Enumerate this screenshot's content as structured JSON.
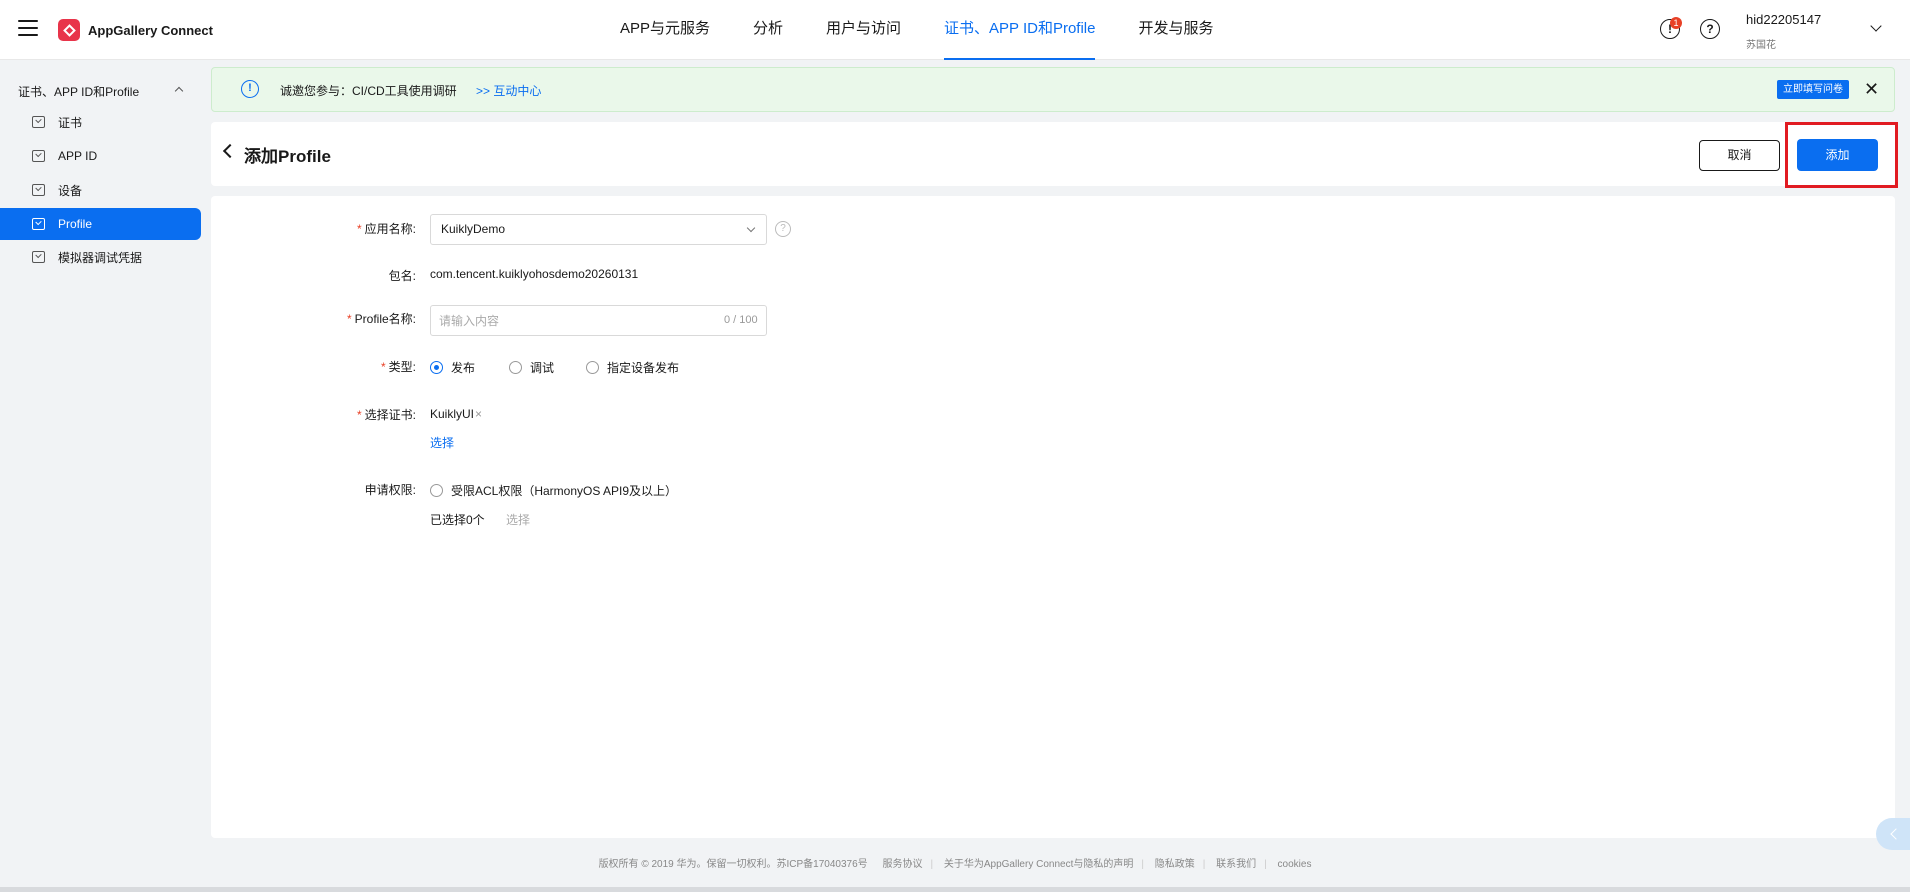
{
  "app": {
    "logo_text": "AppGallery Connect"
  },
  "topnav": {
    "items": [
      "APP与元服务",
      "分析",
      "用户与访问",
      "证书、APP ID和Profile",
      "开发与服务"
    ],
    "active_index": 3
  },
  "header_icons": {
    "notification_badge": "1"
  },
  "user": {
    "id": "hid22205147",
    "name": "苏国花"
  },
  "sidebar": {
    "section_title": "证书、APP ID和Profile",
    "items": [
      "证书",
      "APP ID",
      "设备",
      "Profile",
      "模拟器调试凭据"
    ],
    "active_index": 3
  },
  "notice": {
    "text": "诚邀您参与：CI/CD工具使用调研",
    "link": ">> 互动中心",
    "survey_button": "立即填写问卷"
  },
  "page": {
    "title": "添加Profile",
    "cancel_label": "取消",
    "add_label": "添加"
  },
  "form": {
    "app_name_label": "应用名称:",
    "app_name_value": "KuiklyDemo",
    "package_label": "包名:",
    "package_value": "com.tencent.kuiklyohosdemo20260131",
    "profile_name_label": "Profile名称:",
    "profile_name_placeholder": "请输入内容",
    "profile_name_counter": "0 / 100",
    "type_label": "类型:",
    "type_options": [
      "发布",
      "调试",
      "指定设备发布"
    ],
    "type_selected_index": 0,
    "cert_label": "选择证书:",
    "cert_value": "KuiklyUI",
    "cert_select": "选择",
    "permission_label": "申请权限:",
    "permission_option": "受限ACL权限（HarmonyOS API9及以上）",
    "permission_selected_count": "已选择0个",
    "permission_select": "选择"
  },
  "footer": {
    "copyright": "版权所有 © 2019 华为。保留一切权利。苏ICP备17040376号",
    "links": [
      "服务协议",
      "关于华为AppGallery Connect与隐私的声明",
      "隐私政策",
      "联系我们",
      "cookies"
    ]
  },
  "colors": {
    "accent": "#0a6ef0",
    "highlight": "#e11b22",
    "notice_bg": "#eaf8ea"
  }
}
